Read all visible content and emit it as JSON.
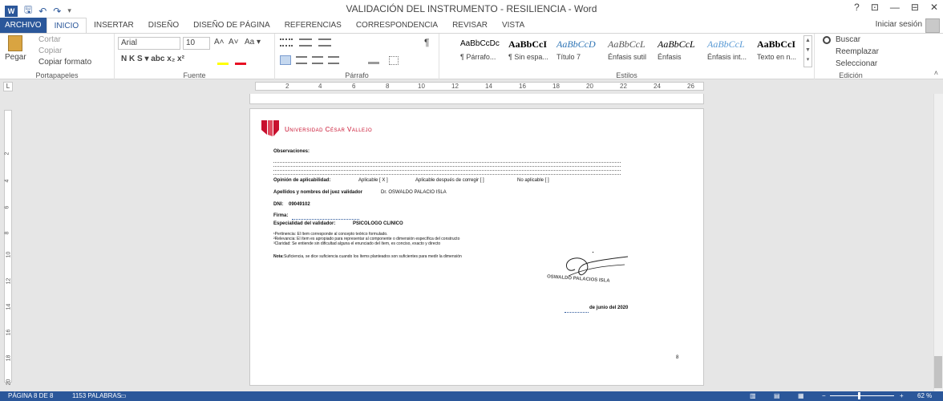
{
  "window": {
    "title": "VALIDACIÓN DEL INSTRUMENTO - RESILIENCIA - Word",
    "controls": [
      "?",
      "⊡",
      "—",
      "⊟",
      "✕"
    ]
  },
  "tabs": [
    "ARCHIVO",
    "INICIO",
    "INSERTAR",
    "DISEÑO",
    "DISEÑO DE PÁGINA",
    "REFERENCIAS",
    "CORRESPONDENCIA",
    "REVISAR",
    "VISTA"
  ],
  "signin": "Iniciar sesión",
  "ribbon": {
    "clipboard": {
      "paste": "Pegar",
      "cut": "Cortar",
      "copy": "Copiar",
      "format_painter": "Copiar formato",
      "label": "Portapapeles"
    },
    "font": {
      "name": "Arial",
      "size": "10",
      "label": "Fuente",
      "row2": "N  K  S  ▾  abc  x₂  x²",
      "grow": "A˄",
      "shrink": "A˅",
      "case": "Aa ▾"
    },
    "paragraph": {
      "label": "Párrafo",
      "mark": "¶"
    },
    "styles": {
      "label": "Estilos",
      "items": [
        {
          "preview": "AaBbCcDc",
          "name": "¶ Párrafo..."
        },
        {
          "preview": "AaBbCcI",
          "name": "¶ Sin espa..."
        },
        {
          "preview": "AaBbCcD",
          "name": "Título 7"
        },
        {
          "preview": "AaBbCcL",
          "name": "Énfasis sutil"
        },
        {
          "preview": "AaBbCcL",
          "name": "Énfasis"
        },
        {
          "preview": "AaBbCcL",
          "name": "Énfasis int..."
        },
        {
          "preview": "AaBbCcI",
          "name": "Texto en n..."
        }
      ]
    },
    "editing": {
      "find": "Buscar",
      "replace": "Reemplazar",
      "select": "Seleccionar",
      "label": "Edición"
    }
  },
  "ruler": {
    "h": [
      "2",
      "4",
      "6",
      "8",
      "10",
      "12",
      "14",
      "16",
      "18",
      "20",
      "22",
      "24",
      "26"
    ],
    "v": [
      "2",
      "4",
      "6",
      "8",
      "10",
      "12",
      "14",
      "16",
      "18",
      "20"
    ]
  },
  "document": {
    "university": "Universidad César Vallejo",
    "observaciones": "Observaciones:",
    "opinion_label": "Opinión de aplicabilidad:",
    "opt1": "Aplicable [ X ]",
    "opt2": "Aplicable después de corregir [ ]",
    "opt3": "No aplicable [ ]",
    "names_label": "Apellidos y nombres del juez validador",
    "names_value": "Dr. OSWALDO PALACIO ISLA",
    "dni_label": "DNI:",
    "dni_value": "09049102",
    "firma_label": "Firma:",
    "especialidad_label": "Especialidad del validador:",
    "especialidad_value": "PSICOLOGO CLINICO",
    "note1": "¹Pertinencia: El ítem corresponde al concepto teórico formulado.",
    "note2": "²Relevancia: El ítem es apropiado para representar al componente o dimensión específica del constructo",
    "note3": "³Claridad: Se entiende sin dificultad alguna el enunciado del ítem, es conciso, exacto y directo",
    "nota_label": "Nota:",
    "nota_text": "Suficiencia, se dice suficiencia cuando los ítems planteados son suficientes para medir la dimensión",
    "stamp": "OSWALDO PALACIOS ISLA",
    "date": "de junio del 2020",
    "page_number": "8"
  },
  "status": {
    "page": "PÁGINA 8 DE 8",
    "words": "1153 PALABRAS",
    "zoom": "62 %"
  },
  "colors": {
    "accent": "#2b579a",
    "ucv_red": "#c8102e"
  }
}
